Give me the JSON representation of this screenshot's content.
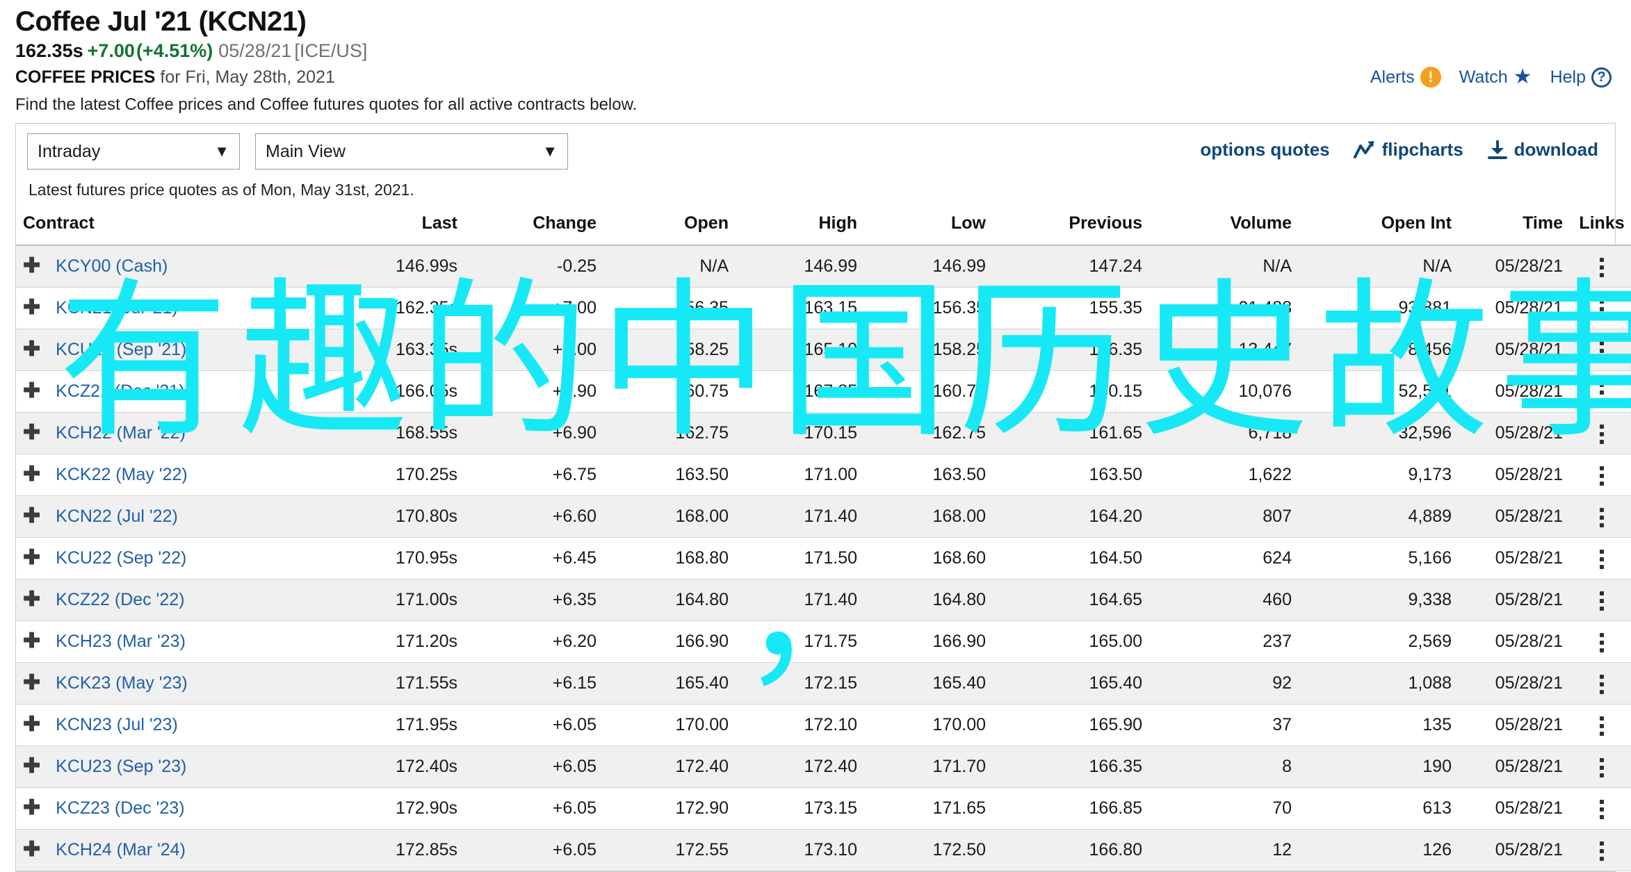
{
  "header": {
    "symbol_title": "Coffee Jul '21 (KCN21)",
    "last_price": "162.35s",
    "change": "+7.00",
    "change_pct": "(+4.51%)",
    "quote_date": "05/28/21",
    "exchange": "[ICE/US]",
    "prices_label": "COFFEE PRICES",
    "prices_for": "for Fri, May 28th, 2021",
    "description": "Find the latest Coffee prices and Coffee futures quotes for all active contracts below.",
    "util_links": [
      {
        "label": "Alerts",
        "icon": "alert-exclamation-icon"
      },
      {
        "label": "Watch",
        "icon": "star-icon"
      },
      {
        "label": "Help",
        "icon": "question-mark-icon"
      }
    ]
  },
  "toolbar": {
    "period_select": "Intraday",
    "view_select": "Main View",
    "links": [
      {
        "label": "options quotes",
        "icon": "none"
      },
      {
        "label": "flipcharts",
        "icon": "flipchart-icon"
      },
      {
        "label": "download",
        "icon": "download-icon"
      }
    ],
    "as_of": "Latest futures price quotes as of Mon, May 31st, 2021."
  },
  "table": {
    "columns": [
      "Contract",
      "Last",
      "Change",
      "Open",
      "High",
      "Low",
      "Previous",
      "Volume",
      "Open Int",
      "Time",
      "Links"
    ],
    "rows": [
      {
        "contract": "KCY00 (Cash)",
        "last": "146.99s",
        "change": "-0.25",
        "dir": "down",
        "open": "N/A",
        "high": "146.99",
        "low": "146.99",
        "previous": "147.24",
        "volume": "N/A",
        "open_int": "N/A",
        "time": "05/28/21"
      },
      {
        "contract": "KCN21 (Jul '21)",
        "last": "162.35s",
        "change": "+7.00",
        "dir": "up",
        "open": "156.35",
        "high": "163.15",
        "low": "156.35",
        "previous": "155.35",
        "volume": "21,488",
        "open_int": "93,881",
        "time": "05/28/21"
      },
      {
        "contract": "KCU21 (Sep '21)",
        "last": "163.35s",
        "change": "+7.00",
        "dir": "up",
        "open": "158.25",
        "high": "165.10",
        "low": "158.25",
        "previous": "156.35",
        "volume": "13,447",
        "open_int": "78,456",
        "time": "05/28/21"
      },
      {
        "contract": "KCZ21 (Dec '21)",
        "last": "166.05s",
        "change": "+5.90",
        "dir": "up",
        "open": "160.75",
        "high": "167.85",
        "low": "160.75",
        "previous": "160.15",
        "volume": "10,076",
        "open_int": "52,541",
        "time": "05/28/21"
      },
      {
        "contract": "KCH22 (Mar '22)",
        "last": "168.55s",
        "change": "+6.90",
        "dir": "up",
        "open": "162.75",
        "high": "170.15",
        "low": "162.75",
        "previous": "161.65",
        "volume": "6,718",
        "open_int": "32,596",
        "time": "05/28/21"
      },
      {
        "contract": "KCK22 (May '22)",
        "last": "170.25s",
        "change": "+6.75",
        "dir": "up",
        "open": "163.50",
        "high": "171.00",
        "low": "163.50",
        "previous": "163.50",
        "volume": "1,622",
        "open_int": "9,173",
        "time": "05/28/21"
      },
      {
        "contract": "KCN22 (Jul '22)",
        "last": "170.80s",
        "change": "+6.60",
        "dir": "up",
        "open": "168.00",
        "high": "171.40",
        "low": "168.00",
        "previous": "164.20",
        "volume": "807",
        "open_int": "4,889",
        "time": "05/28/21"
      },
      {
        "contract": "KCU22 (Sep '22)",
        "last": "170.95s",
        "change": "+6.45",
        "dir": "up",
        "open": "168.80",
        "high": "171.50",
        "low": "168.60",
        "previous": "164.50",
        "volume": "624",
        "open_int": "5,166",
        "time": "05/28/21"
      },
      {
        "contract": "KCZ22 (Dec '22)",
        "last": "171.00s",
        "change": "+6.35",
        "dir": "up",
        "open": "164.80",
        "high": "171.40",
        "low": "164.80",
        "previous": "164.65",
        "volume": "460",
        "open_int": "9,338",
        "time": "05/28/21"
      },
      {
        "contract": "KCH23 (Mar '23)",
        "last": "171.20s",
        "change": "+6.20",
        "dir": "up",
        "open": "166.90",
        "high": "171.75",
        "low": "166.90",
        "previous": "165.00",
        "volume": "237",
        "open_int": "2,569",
        "time": "05/28/21"
      },
      {
        "contract": "KCK23 (May '23)",
        "last": "171.55s",
        "change": "+6.15",
        "dir": "up",
        "open": "165.40",
        "high": "172.15",
        "low": "165.40",
        "previous": "165.40",
        "volume": "92",
        "open_int": "1,088",
        "time": "05/28/21"
      },
      {
        "contract": "KCN23 (Jul '23)",
        "last": "171.95s",
        "change": "+6.05",
        "dir": "up",
        "open": "170.00",
        "high": "172.10",
        "low": "170.00",
        "previous": "165.90",
        "volume": "37",
        "open_int": "135",
        "time": "05/28/21"
      },
      {
        "contract": "KCU23 (Sep '23)",
        "last": "172.40s",
        "change": "+6.05",
        "dir": "up",
        "open": "172.40",
        "high": "172.40",
        "low": "171.70",
        "previous": "166.35",
        "volume": "8",
        "open_int": "190",
        "time": "05/28/21"
      },
      {
        "contract": "KCZ23 (Dec '23)",
        "last": "172.90s",
        "change": "+6.05",
        "dir": "up",
        "open": "172.90",
        "high": "173.15",
        "low": "171.65",
        "previous": "166.85",
        "volume": "70",
        "open_int": "613",
        "time": "05/28/21"
      },
      {
        "contract": "KCH24 (Mar '24)",
        "last": "172.85s",
        "change": "+6.05",
        "dir": "up",
        "open": "172.55",
        "high": "173.10",
        "low": "172.50",
        "previous": "166.80",
        "volume": "12",
        "open_int": "126",
        "time": "05/28/21"
      }
    ]
  },
  "watermark": {
    "line1": "有趣的中国历史故事",
    "line2": "，",
    "color": "#16e9f5"
  },
  "colors": {
    "link_blue": "#1f5fa8",
    "up_green": "#137333",
    "down_red": "#c02020",
    "accent_orange": "#f5a01c",
    "dark_blue": "#104879"
  }
}
